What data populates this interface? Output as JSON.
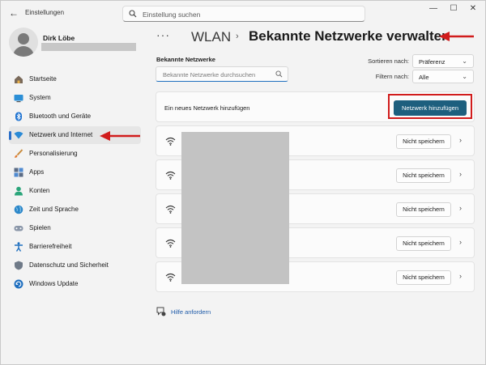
{
  "titlebar": {
    "app_title": "Einstellungen",
    "search_placeholder": "Einstellung suchen"
  },
  "profile": {
    "name": "Dirk Löbe"
  },
  "sidebar": {
    "items": [
      {
        "label": "Startseite",
        "icon": "home-icon"
      },
      {
        "label": "System",
        "icon": "system-icon"
      },
      {
        "label": "Bluetooth und Geräte",
        "icon": "bluetooth-icon"
      },
      {
        "label": "Netzwerk und Internet",
        "icon": "network-icon",
        "active": true
      },
      {
        "label": "Personalisierung",
        "icon": "brush-icon"
      },
      {
        "label": "Apps",
        "icon": "apps-icon"
      },
      {
        "label": "Konten",
        "icon": "account-icon"
      },
      {
        "label": "Zeit und Sprache",
        "icon": "globe-icon"
      },
      {
        "label": "Spielen",
        "icon": "gamepad-icon"
      },
      {
        "label": "Barrierefreiheit",
        "icon": "accessibility-icon"
      },
      {
        "label": "Datenschutz und Sicherheit",
        "icon": "shield-icon"
      },
      {
        "label": "Windows Update",
        "icon": "update-icon"
      }
    ]
  },
  "header": {
    "more": "···",
    "crumb1": "WLAN",
    "separator": "›",
    "crumb2": "Bekannte Netzwerke verwalten"
  },
  "main": {
    "section_label": "Bekannte Netzwerke",
    "filter_placeholder": "Bekannte Netzwerke durchsuchen",
    "sort_label": "Sortieren nach:",
    "sort_value": "Präferenz",
    "filter_label": "Filtern nach:",
    "filter_value": "Alle",
    "add_label": "Ein neues Netzwerk hinzufügen",
    "add_button": "Netzwerk hinzufügen",
    "networks": [
      {
        "forget": "Nicht speichern"
      },
      {
        "forget": "Nicht speichern"
      },
      {
        "forget": "Nicht speichern"
      },
      {
        "forget": "Nicht speichern"
      },
      {
        "forget": "Nicht speichern"
      }
    ],
    "help": "Hilfe anfordern"
  },
  "colors": {
    "accent": "#1d5f7e",
    "annotation_red": "#d11c1c",
    "nav_indicator": "#2b6fc9"
  }
}
